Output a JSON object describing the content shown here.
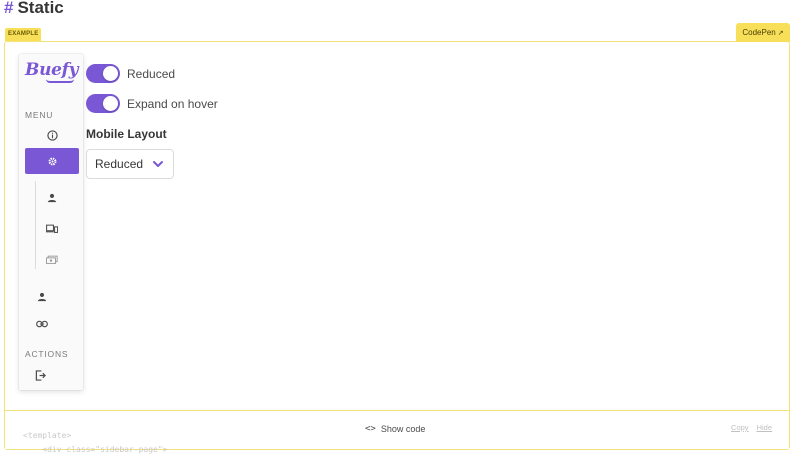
{
  "page": {
    "hash": "#",
    "title": "Static"
  },
  "example": {
    "tag": "EXAMPLE",
    "codepen_label": "CodePen"
  },
  "sidebar": {
    "logo": "Buefy",
    "menu_label": "MENU",
    "actions_label": "ACTIONS",
    "items": [
      {
        "icon": "info-circle-icon"
      },
      {
        "icon": "cog-icon",
        "active": true
      },
      {
        "icon": "account-icon"
      },
      {
        "icon": "cellphone-link-icon"
      },
      {
        "icon": "cash-multiple-icon"
      },
      {
        "icon": "account-icon"
      },
      {
        "icon": "link-icon"
      },
      {
        "icon": "logout-icon"
      }
    ]
  },
  "controls": {
    "reduced_label": "Reduced",
    "reduced_on": true,
    "expand_label": "Expand on hover",
    "expand_on": true,
    "mobile_layout_label": "Mobile Layout",
    "mobile_layout_value": "Reduced"
  },
  "code_bar": {
    "show_code": "Show code",
    "copy": "Copy",
    "hide": "Hide",
    "ghost_line1": "<template>",
    "ghost_line2": "    <div class=\"sidebar-page\">"
  },
  "colors": {
    "accent": "#7957d5",
    "example_yellow": "#f7df5a"
  }
}
